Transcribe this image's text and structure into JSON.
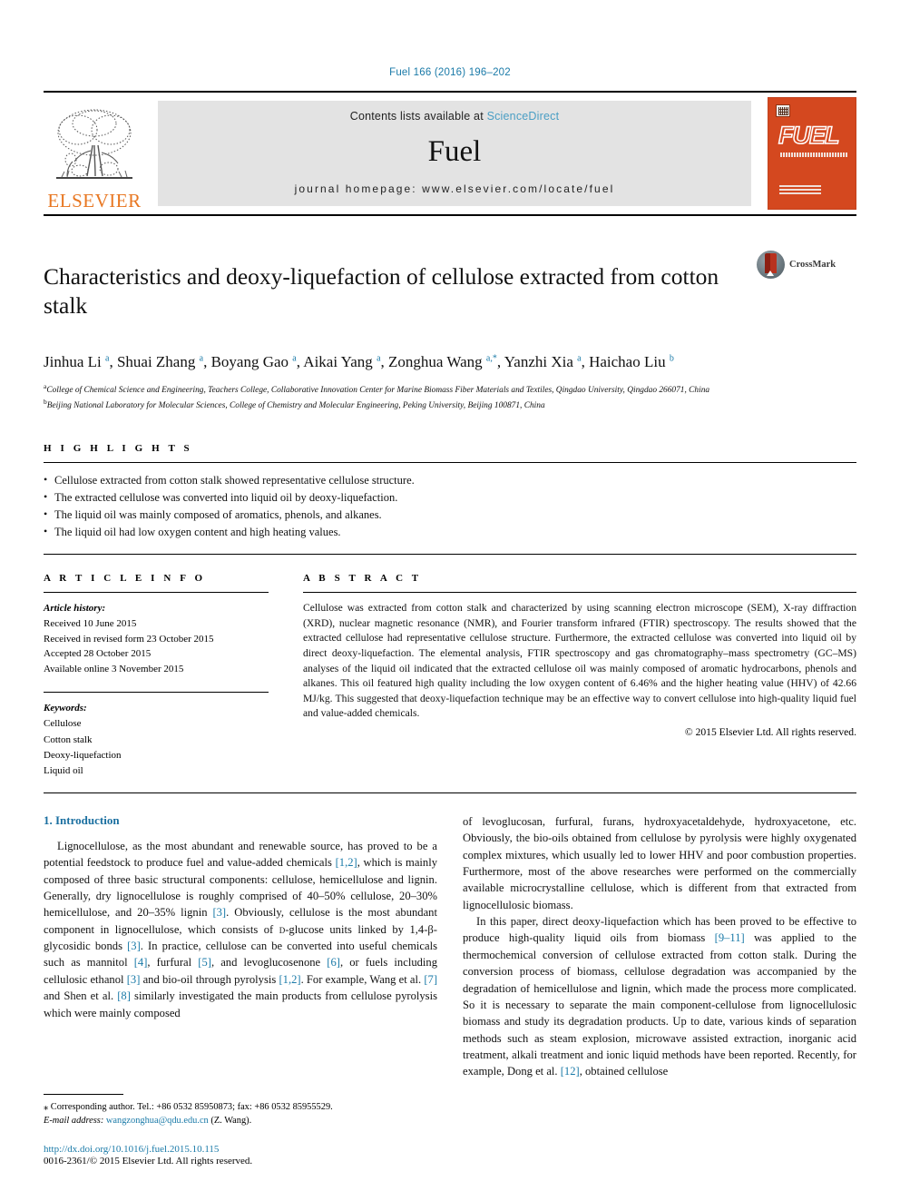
{
  "running_head": "Fuel 166 (2016) 196–202",
  "masthead": {
    "publisher_name": "ELSEVIER",
    "contents_prefix": "Contents lists available at",
    "contents_link": "ScienceDirect",
    "journal_title": "Fuel",
    "homepage": "journal homepage: www.elsevier.com/locate/fuel",
    "cover_word": "FUEL",
    "link_color": "#4a9ec4",
    "elsevier_orange": "#e87722",
    "cover_orange": "#d4481f"
  },
  "article": {
    "title": "Characteristics and deoxy-liquefaction of cellulose extracted from cotton stalk",
    "crossmark_label": "CrossMark",
    "authors_html": "Jinhua Li <sup>a</sup>, Shuai Zhang <sup>a</sup>, Boyang Gao <sup>a</sup>, Aikai Yang <sup>a</sup>, Zonghua Wang <sup>a,</sup><sup>*</sup>, Yanzhi Xia <sup>a</sup>, Haichao Liu <sup>b</sup>",
    "affiliations": [
      {
        "marker": "a",
        "text": "College of Chemical Science and Engineering, Teachers College, Collaborative Innovation Center for Marine Biomass Fiber Materials and Textiles, Qingdao University, Qingdao 266071, China"
      },
      {
        "marker": "b",
        "text": "Beijing National Laboratory for Molecular Sciences, College of Chemistry and Molecular Engineering, Peking University, Beijing 100871, China"
      }
    ]
  },
  "highlights": {
    "label": "H I G H L I G H T S",
    "items": [
      "Cellulose extracted from cotton stalk showed representative cellulose structure.",
      "The extracted cellulose was converted into liquid oil by deoxy-liquefaction.",
      "The liquid oil was mainly composed of aromatics, phenols, and alkanes.",
      "The liquid oil had low oxygen content and high heating values."
    ]
  },
  "article_info": {
    "label": "A R T I C L E  I N F O",
    "history_heading": "Article history:",
    "history": [
      "Received 10 June 2015",
      "Received in revised form 23 October 2015",
      "Accepted 28 October 2015",
      "Available online 3 November 2015"
    ],
    "keywords_heading": "Keywords:",
    "keywords": [
      "Cellulose",
      "Cotton stalk",
      "Deoxy-liquefaction",
      "Liquid oil"
    ]
  },
  "abstract": {
    "label": "A B S T R A C T",
    "text": "Cellulose was extracted from cotton stalk and characterized by using scanning electron microscope (SEM), X-ray diffraction (XRD), nuclear magnetic resonance (NMR), and Fourier transform infrared (FTIR) spectroscopy. The results showed that the extracted cellulose had representative cellulose structure. Furthermore, the extracted cellulose was converted into liquid oil by direct deoxy-liquefaction. The elemental analysis, FTIR spectroscopy and gas chromatography–mass spectrometry (GC–MS) analyses of the liquid oil indicated that the extracted cellulose oil was mainly composed of aromatic hydrocarbons, phenols and alkanes. This oil featured high quality including the low oxygen content of 6.46% and the higher heating value (HHV) of 42.66 MJ/kg. This suggested that deoxy-liquefaction technique may be an effective way to convert cellulose into high-quality liquid fuel and value-added chemicals.",
    "copyright": "© 2015 Elsevier Ltd. All rights reserved."
  },
  "introduction": {
    "heading": "1. Introduction",
    "left_para_1_html": "Lignocellulose, as the most abundant and renewable source, has proved to be a potential feedstock to produce fuel and value-added chemicals <span class=\"ref\">[1,2]</span>, which is mainly composed of three basic structural components: cellulose, hemicellulose and lignin. Generally, dry lignocellulose is roughly comprised of 40–50% cellulose, 20–30% hemicellulose, and 20–35% lignin <span class=\"ref\">[3]</span>. Obviously, cellulose is the most abundant component in lignocellulose, which consists of <span class=\"sc\">d</span>-glucose units linked by 1,4-β-glycosidic bonds <span class=\"ref\">[3]</span>. In practice, cellulose can be converted into useful chemicals such as mannitol <span class=\"ref\">[4]</span>, furfural <span class=\"ref\">[5]</span>, and levoglucosenone <span class=\"ref\">[6]</span>, or fuels including cellulosic ethanol <span class=\"ref\">[3]</span> and bio-oil through pyrolysis <span class=\"ref\">[1,2]</span>. For example, Wang et al. <span class=\"ref\">[7]</span> and Shen et al. <span class=\"ref\">[8]</span> similarly investigated the main products from cellulose pyrolysis which were mainly composed",
    "right_para_1_html": "of levoglucosan, furfural, furans, hydroxyacetaldehyde, hydroxyacetone, etc. Obviously, the bio-oils obtained from cellulose by pyrolysis were highly oxygenated complex mixtures, which usually led to lower HHV and poor combustion properties. Furthermore, most of the above researches were performed on the commercially available microcrystalline cellulose, which is different from that extracted from lignocellulosic biomass.",
    "right_para_2_html": "In this paper, direct deoxy-liquefaction which has been proved to be effective to produce high-quality liquid oils from biomass <span class=\"ref\">[9–11]</span> was applied to the thermochemical conversion of cellulose extracted from cotton stalk. During the conversion process of biomass, cellulose degradation was accompanied by the degradation of hemicellulose and lignin, which made the process more complicated. So it is necessary to separate the main component-cellulose from lignocellulosic biomass and study its degradation products. Up to date, various kinds of separation methods such as steam explosion, microwave assisted extraction, inorganic acid treatment, alkali treatment and ionic liquid methods have been reported. Recently, for example, Dong et al. <span class=\"ref\">[12]</span>, obtained cellulose"
  },
  "footnote": {
    "corresponding": "⁎ Corresponding author. Tel.: +86 0532 85950873; fax: +86 0532 85955529.",
    "email_label": "E-mail address:",
    "email": "wangzonghua@qdu.edu.cn",
    "email_suffix": "(Z. Wang).",
    "doi": "http://dx.doi.org/10.1016/j.fuel.2015.10.115",
    "issn": "0016-2361/© 2015 Elsevier Ltd. All rights reserved."
  }
}
